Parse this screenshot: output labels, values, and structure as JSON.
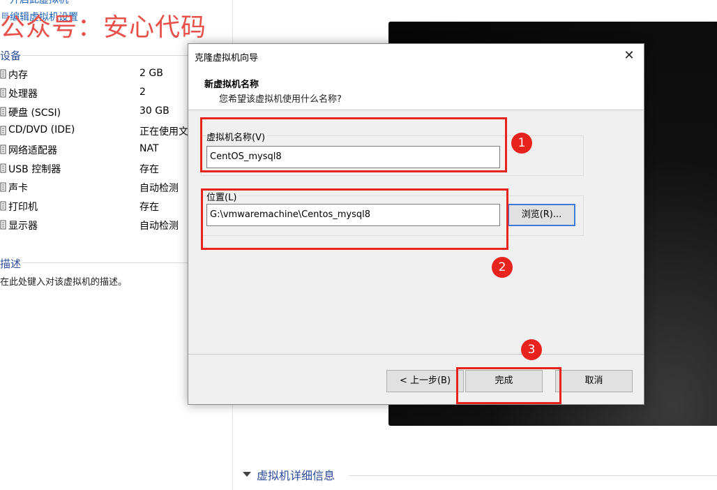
{
  "left": {
    "top_link": "开启此虚拟机",
    "edit_link": "编辑虚拟机设置",
    "watermark": "公众号：安心代码",
    "devices_title": "设备",
    "devices": [
      {
        "name": "内存",
        "value": "2 GB",
        "icon": "memory-icon"
      },
      {
        "name": "处理器",
        "value": "2",
        "icon": "cpu-icon"
      },
      {
        "name": "硬盘 (SCSI)",
        "value": "30 GB",
        "icon": "disk-icon"
      },
      {
        "name": "CD/DVD (IDE)",
        "value": "正在使用文",
        "icon": "cd-icon"
      },
      {
        "name": "网络适配器",
        "value": "NAT",
        "icon": "network-icon"
      },
      {
        "name": "USB 控制器",
        "value": "存在",
        "icon": "usb-icon"
      },
      {
        "name": "声卡",
        "value": "自动检测",
        "icon": "sound-icon"
      },
      {
        "name": "打印机",
        "value": "存在",
        "icon": "printer-icon"
      },
      {
        "name": "显示器",
        "value": "自动检测",
        "icon": "display-icon"
      }
    ],
    "desc_title": "描述",
    "desc_text": "在此处键入对该虚拟机的描述。"
  },
  "right": {
    "details_title": "虚拟机详细信息"
  },
  "dialog": {
    "title": "克隆虚拟机向导",
    "close_glyph": "✕",
    "heading": "新虚拟机名称",
    "subheading": "您希望该虚拟机使用什么名称?",
    "name_label": "虚拟机名称(V)",
    "name_value": "CentOS_mysql8",
    "location_label": "位置(L)",
    "location_value": "G:\\vmwaremachine\\Centos_mysql8",
    "browse_label": "浏览(R)...",
    "back_label": "< 上一步(B)",
    "finish_label": "完成",
    "cancel_label": "取消"
  },
  "annotations": {
    "badge1": "1",
    "badge2": "2",
    "badge3": "3",
    "color": "#e8231e"
  }
}
